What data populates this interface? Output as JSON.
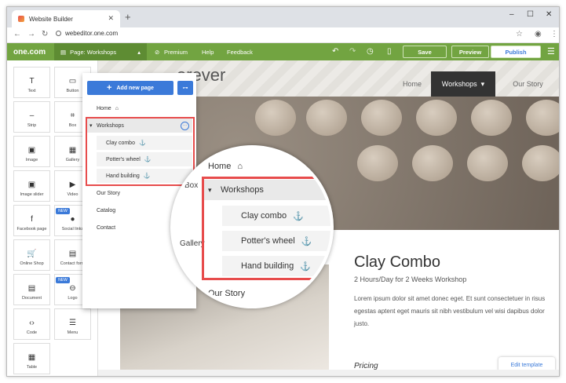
{
  "browser": {
    "tab_title": "Website Builder",
    "new_tab": "+",
    "url": "webeditor.one.com",
    "window_controls": [
      "–",
      "☐",
      "✕"
    ]
  },
  "toolbar": {
    "logo": "one.com",
    "page_selector": "Page: Workshops",
    "premium": "Premium",
    "help": "Help",
    "feedback": "Feedback",
    "save": "Save",
    "preview": "Preview",
    "publish": "Publish"
  },
  "widgets": [
    {
      "label": "Text",
      "icon": "T"
    },
    {
      "label": "Button",
      "icon": "▭"
    },
    {
      "label": "Strip",
      "icon": "–"
    },
    {
      "label": "Box",
      "icon": "⌗"
    },
    {
      "label": "Image",
      "icon": "▣"
    },
    {
      "label": "Gallery",
      "icon": "▦"
    },
    {
      "label": "Image slider",
      "icon": "▣"
    },
    {
      "label": "Video",
      "icon": "▶"
    },
    {
      "label": "Facebook page",
      "icon": "f"
    },
    {
      "label": "Social links",
      "icon": "●"
    },
    {
      "label": "Online Shop",
      "icon": "🛒"
    },
    {
      "label": "Contact form",
      "icon": "▤"
    },
    {
      "label": "Document",
      "icon": "▤"
    },
    {
      "label": "Logo",
      "icon": "⊖"
    },
    {
      "label": "Code",
      "icon": "‹›"
    },
    {
      "label": "Menu",
      "icon": "☰"
    },
    {
      "label": "Table",
      "icon": "▦"
    }
  ],
  "new_badge": "NEW",
  "pages_panel": {
    "add_page": "Add new page",
    "items": [
      "Home",
      "Workshops",
      "Clay combo",
      "Potter's wheel",
      "Hand building",
      "Our Story",
      "Catalog",
      "Contact"
    ]
  },
  "zoom_lens": {
    "items": [
      "Home",
      "Workshops",
      "Clay combo",
      "Potter's wheel",
      "Hand building",
      "Our Story"
    ],
    "side_labels": [
      "Box",
      "Gallery"
    ]
  },
  "site": {
    "title": "orever",
    "nav": [
      "Home",
      "Workshops",
      "Our Story"
    ],
    "heading": "Clay Combo",
    "subheading": "2 Hours/Day for 2 Weeks Workshop",
    "body": "Lorem ipsum dolor sit amet donec eget. Et sunt consectetuer in risus egestas aptent eget mauris sit nibh vestibulum vel wisi dapibus dolor justo.",
    "pricing": "Pricing",
    "edit_template": "Edit template"
  },
  "colors": {
    "accent": "#72a441",
    "highlight": "#e74c4c",
    "primary": "#3b7ad9"
  }
}
